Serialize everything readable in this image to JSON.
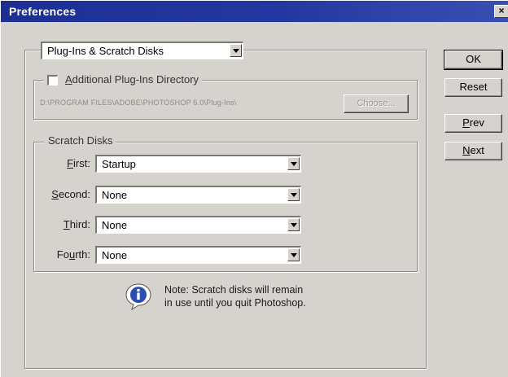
{
  "window": {
    "title": "Preferences",
    "close_glyph": "×"
  },
  "panel_select": {
    "value": "Plug-Ins & Scratch Disks"
  },
  "plugins": {
    "checkbox_label_first": "A",
    "checkbox_label_rest": "dditional Plug-Ins Directory",
    "checked": false,
    "path": "D:\\PROGRAM FILES\\ADOBE\\PHOTOSHOP 6.0\\Plug-Ins\\",
    "choose_label": "Choose..."
  },
  "scratch": {
    "legend": "Scratch Disks",
    "rows": [
      {
        "label_pre": "",
        "label_key": "F",
        "label_post": "irst:",
        "value": "Startup"
      },
      {
        "label_pre": "",
        "label_key": "S",
        "label_post": "econd:",
        "value": "None"
      },
      {
        "label_pre": "",
        "label_key": "T",
        "label_post": "hird:",
        "value": "None"
      },
      {
        "label_pre": "Fo",
        "label_key": "u",
        "label_post": "rth:",
        "value": "None"
      }
    ]
  },
  "note": {
    "icon": "info-icon",
    "line1": "Note: Scratch disks will remain",
    "line2": "in use until you quit Photoshop."
  },
  "buttons": {
    "ok": "OK",
    "reset": "Reset",
    "prev_key": "P",
    "prev_rest": "rev",
    "next_key": "N",
    "next_rest": "ext"
  },
  "colors": {
    "titlebar": "#1c2f93",
    "face": "#d6d3ce",
    "info_blue": "#2a4fb0"
  }
}
